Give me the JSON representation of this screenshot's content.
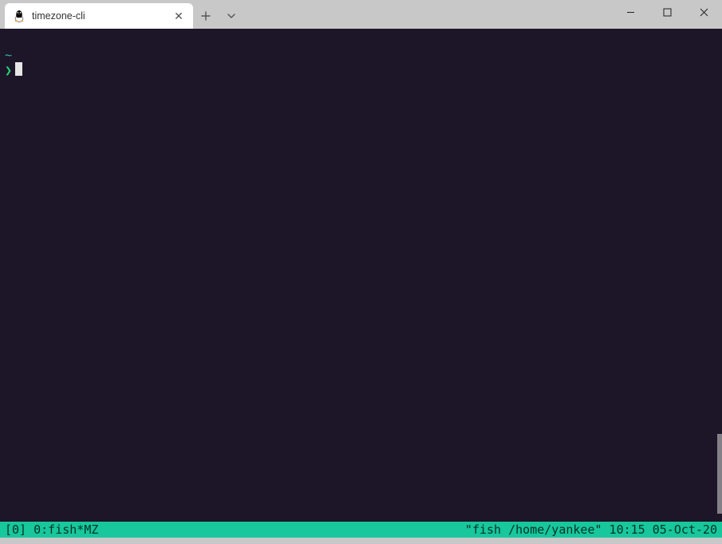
{
  "window": {
    "tab_title": "timezone-cli"
  },
  "terminal": {
    "cwd_line": "~",
    "prompt_glyph": "❯",
    "statusbar": {
      "left": "[0] 0:fish*MZ",
      "right": "\"fish /home/yankee\" 10:15 05-Oct-20"
    }
  }
}
